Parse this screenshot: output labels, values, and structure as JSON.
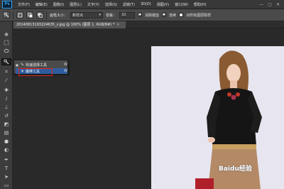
{
  "app": {
    "logo": "Ps"
  },
  "menubar": {
    "items": [
      "文件(F)",
      "编辑(E)",
      "图像(I)",
      "图层(L)",
      "文字(Y)",
      "选择(S)",
      "滤镜(T)",
      "3D(D)",
      "视图(V)",
      "窗口(W)",
      "帮助(H)"
    ],
    "window_controls": [
      "—",
      "▢",
      "✕"
    ]
  },
  "options": {
    "tool_icon": "quick-selection-icon",
    "brush_size_label": "画笔大小：",
    "brush_size_value": "新样点",
    "tolerance_label": "容差：",
    "tolerance_value": "32",
    "anti_alias_label": "消除锯齿",
    "contiguous_label": "连续",
    "sample_all_label": "对所有图层取样"
  },
  "document": {
    "tab_title": "20140813193224635_s.jpg @ 100% (图层 1, RGB/8#) *",
    "tab_close": "×"
  },
  "flyout": {
    "items": [
      {
        "icon": "quick-selection-icon",
        "label": "快速选择工具",
        "shortcut": "W"
      },
      {
        "icon": "magic-wand-icon",
        "label": "魔棒工具",
        "shortcut": "W"
      }
    ]
  },
  "watermark": "Baidu经验",
  "colors": {
    "highlight": "#e0261b",
    "selected_row": "#2f5c9e",
    "accent": "#31a8ff"
  }
}
